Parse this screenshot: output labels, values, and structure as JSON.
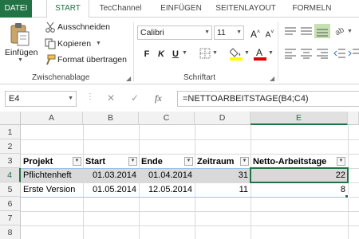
{
  "ribbon_tabs": [
    {
      "label": "DATEI",
      "active": false,
      "file": true
    },
    {
      "label": "START",
      "active": true,
      "file": false
    },
    {
      "label": "TecChannel",
      "active": false,
      "file": false
    },
    {
      "label": "EINFÜGEN",
      "active": false,
      "file": false
    },
    {
      "label": "SEITENLAYOUT",
      "active": false,
      "file": false
    },
    {
      "label": "FORMELN",
      "active": false,
      "file": false
    }
  ],
  "clipboard": {
    "paste_label": "Einfügen",
    "cut_label": "Ausschneiden",
    "copy_label": "Kopieren",
    "format_painter_label": "Format übertragen",
    "group_label": "Zwischenablage"
  },
  "font": {
    "font_name": "Calibri",
    "font_size": "11",
    "bold": "F",
    "italic": "K",
    "underline": "U",
    "group_label": "Schriftart"
  },
  "formula_bar": {
    "name_box": "E4",
    "fx_label": "fx",
    "formula": "=NETTOARBEITSTAGE(B4;C4)"
  },
  "columns": [
    "A",
    "B",
    "C",
    "D",
    "E"
  ],
  "rows": [
    "1",
    "2",
    "3",
    "4",
    "5",
    "6",
    "7",
    "8"
  ],
  "table": {
    "headers": [
      "Projekt",
      "Start",
      "Ende",
      "Zeitraum",
      "Netto-Arbeitstage"
    ],
    "rows": [
      [
        "Pflichtenheft",
        "01.03.2014",
        "01.04.2014",
        "31",
        "22"
      ],
      [
        "Erste Version",
        "01.05.2014",
        "12.05.2014",
        "11",
        "8"
      ]
    ]
  },
  "colors": {
    "accent": "#217346",
    "selected_row_fill": "#d9d9d9"
  }
}
